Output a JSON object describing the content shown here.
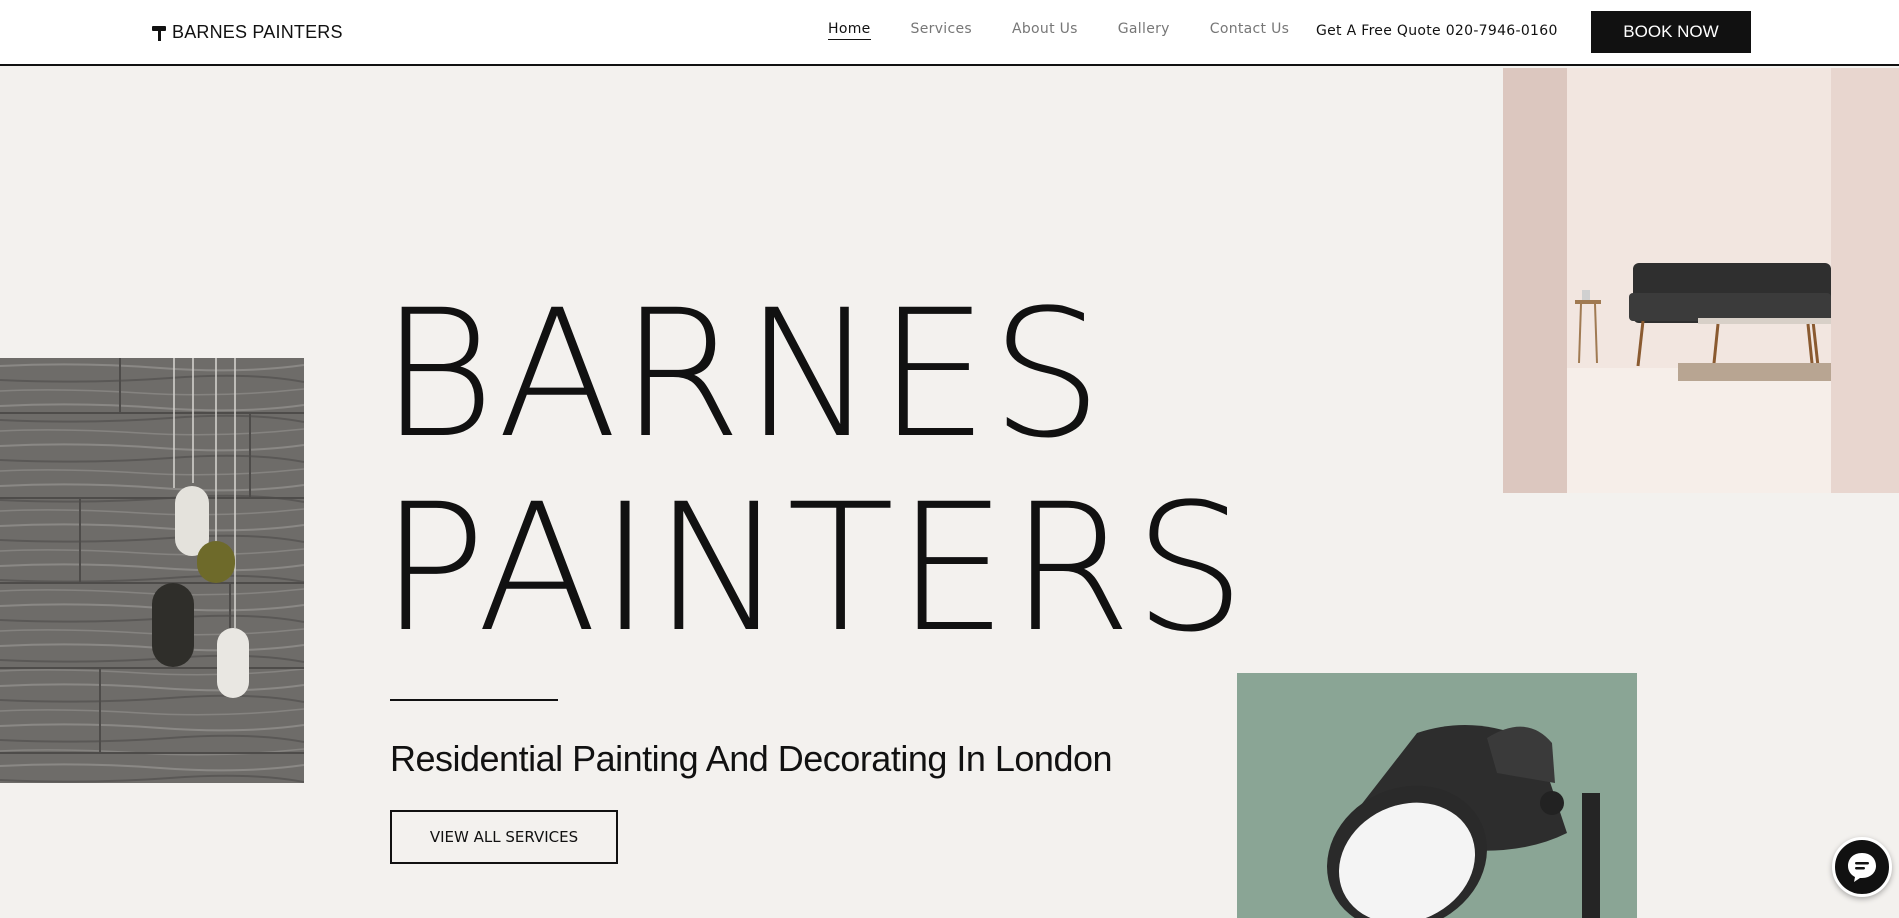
{
  "header": {
    "logo_text": "BARNES PAINTERS",
    "logo_icon": "paint-roller-icon",
    "nav": [
      {
        "label": "Home",
        "active": true
      },
      {
        "label": "Services",
        "active": false
      },
      {
        "label": "About Us",
        "active": false
      },
      {
        "label": "Gallery",
        "active": false
      },
      {
        "label": "Contact Us",
        "active": false
      }
    ],
    "quote_text": "Get A Free Quote 020-7946-0160",
    "book_label": "BOOK NOW"
  },
  "hero": {
    "title_line1": "BARNES",
    "title_line2": "PAINTERS",
    "subtitle": "Residential Painting And Decorating In London",
    "services_button": "VIEW ALL SERVICES"
  },
  "images": {
    "left": "pendant-lamps-image",
    "top_right": "living-room-sofa-image",
    "bottom_right": "desk-lamp-image"
  },
  "chat": {
    "icon": "chat-bubble-icon"
  },
  "colors": {
    "background": "#f3f1ee",
    "primary": "#111111",
    "nav_inactive": "#777777"
  }
}
